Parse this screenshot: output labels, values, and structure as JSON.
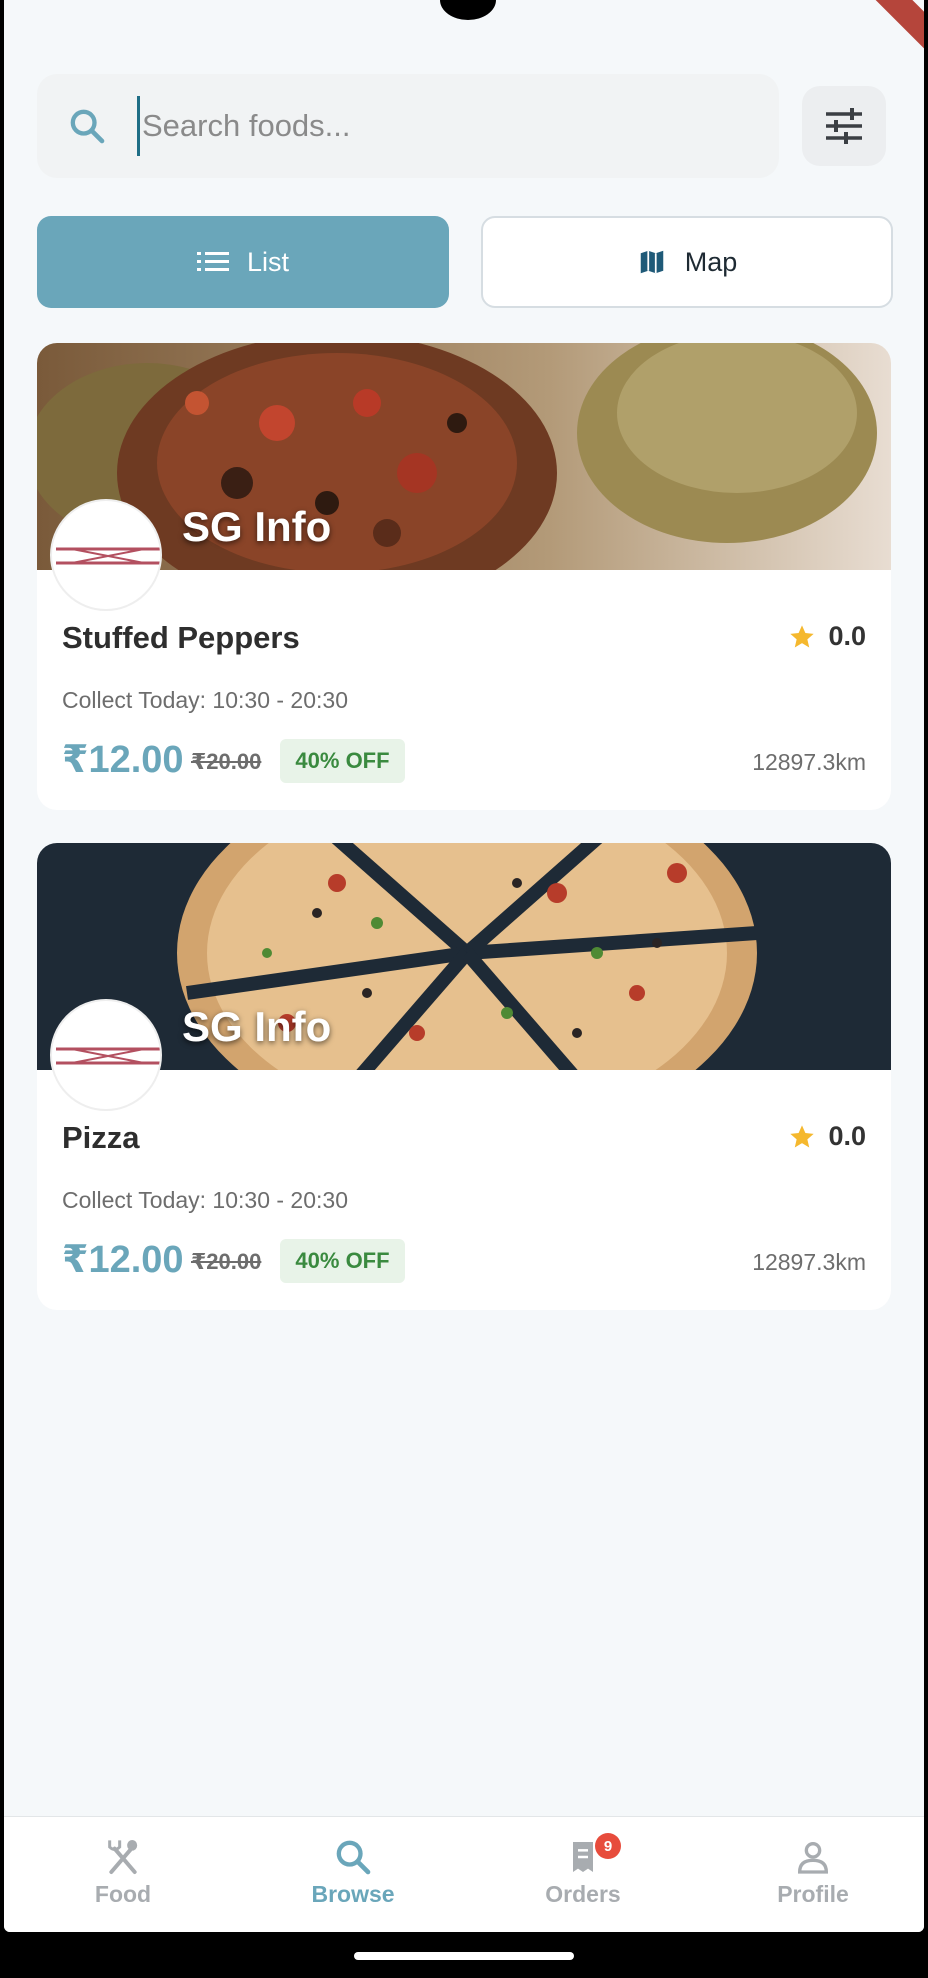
{
  "search": {
    "placeholder": "Search foods..."
  },
  "view_toggle": {
    "list_label": "List",
    "map_label": "Map",
    "active": "list"
  },
  "cards": [
    {
      "store": "SG Info",
      "name": "Stuffed Peppers",
      "rating": "0.0",
      "collect": "Collect Today: 10:30 - 20:30",
      "price": "₹12.00",
      "old_price": "₹20.00",
      "discount": "40% OFF",
      "distance": "12897.3km"
    },
    {
      "store": "SG Info",
      "name": "Pizza",
      "rating": "0.0",
      "collect": "Collect Today: 10:30 - 20:30",
      "price": "₹12.00",
      "old_price": "₹20.00",
      "discount": "40% OFF",
      "distance": "12897.3km"
    }
  ],
  "bottom_nav": {
    "items": [
      {
        "label": "Food",
        "icon": "fork-knife-icon"
      },
      {
        "label": "Browse",
        "icon": "search-icon",
        "active": true
      },
      {
        "label": "Orders",
        "icon": "receipt-icon",
        "badge": "9"
      },
      {
        "label": "Profile",
        "icon": "person-icon"
      }
    ]
  },
  "colors": {
    "accent": "#6aa6ba",
    "discount_text": "#3a8a3f",
    "badge": "#e74c3c",
    "star": "#f5b82e"
  }
}
